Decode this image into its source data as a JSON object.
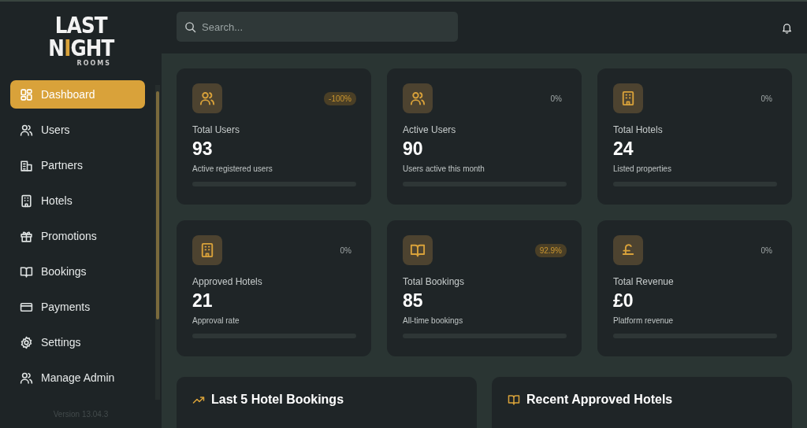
{
  "logo": {
    "top": "LAST",
    "bottom": [
      {
        "text": "N",
        "accent": false
      },
      {
        "text": "I",
        "accent": true
      },
      {
        "text": "GHT",
        "accent": false
      }
    ],
    "tagline": "ROOMS"
  },
  "sidebar": {
    "items": [
      {
        "label": "Dashboard",
        "kind": "grid",
        "selected": true
      },
      {
        "label": "Users",
        "kind": "users",
        "selected": false
      },
      {
        "label": "Partners",
        "kind": "building",
        "selected": false
      },
      {
        "label": "Hotels",
        "kind": "hotel",
        "selected": false
      },
      {
        "label": "Promotions",
        "kind": "gift",
        "selected": false
      },
      {
        "label": "Bookings",
        "kind": "book",
        "selected": false
      },
      {
        "label": "Payments",
        "kind": "card",
        "selected": false
      },
      {
        "label": "Settings",
        "kind": "gear",
        "selected": false
      },
      {
        "label": "Manage Admin",
        "kind": "users",
        "selected": false
      }
    ],
    "version": "Version 13.04.3"
  },
  "search": {
    "placeholder": "Search..."
  },
  "stats": [
    {
      "kind": "users",
      "change": "-100%",
      "highlighted": true,
      "title": "Total Users",
      "value": "93",
      "caption": "Active registered users",
      "level": 0
    },
    {
      "kind": "users",
      "change": "0%",
      "highlighted": false,
      "title": "Active Users",
      "value": "90",
      "caption": "Users active this month",
      "level": 0
    },
    {
      "kind": "hotel",
      "change": "0%",
      "highlighted": false,
      "title": "Total Hotels",
      "value": "24",
      "caption": "Listed properties",
      "level": 0
    },
    {
      "kind": "hotel",
      "change": "0%",
      "highlighted": false,
      "title": "Approved Hotels",
      "value": "21",
      "caption": "Approval rate",
      "level": 0
    },
    {
      "kind": "book",
      "change": "92.9%",
      "highlighted": true,
      "title": "Total Bookings",
      "value": "85",
      "caption": "All-time bookings",
      "level": 0
    },
    {
      "kind": "pound",
      "change": "0%",
      "highlighted": false,
      "title": "Total Revenue",
      "value": "£0",
      "caption": "Platform revenue",
      "level": 0
    }
  ],
  "panels": [
    {
      "kind": "trend",
      "title": "Last 5 Hotel Bookings"
    },
    {
      "kind": "book",
      "title": "Recent Approved Hotels"
    }
  ]
}
